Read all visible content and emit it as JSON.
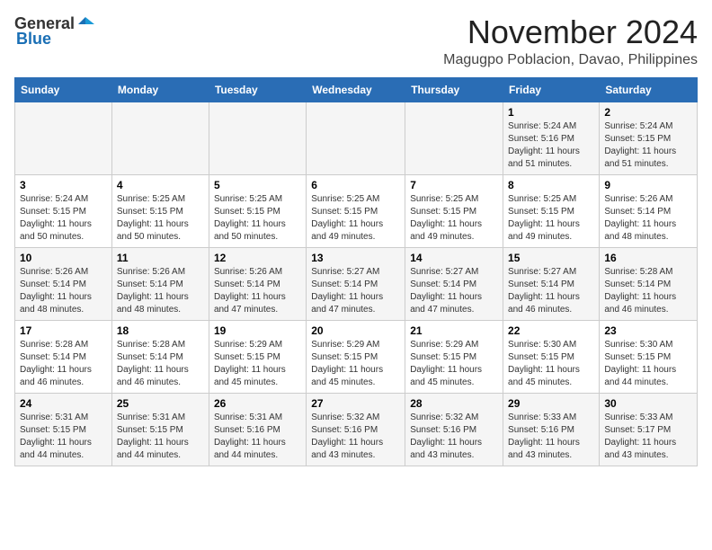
{
  "header": {
    "logo_general": "General",
    "logo_blue": "Blue",
    "month_title": "November 2024",
    "location": "Magugpo Poblacion, Davao, Philippines"
  },
  "weekdays": [
    "Sunday",
    "Monday",
    "Tuesday",
    "Wednesday",
    "Thursday",
    "Friday",
    "Saturday"
  ],
  "weeks": [
    [
      {
        "day": "",
        "sunrise": "",
        "sunset": "",
        "daylight": ""
      },
      {
        "day": "",
        "sunrise": "",
        "sunset": "",
        "daylight": ""
      },
      {
        "day": "",
        "sunrise": "",
        "sunset": "",
        "daylight": ""
      },
      {
        "day": "",
        "sunrise": "",
        "sunset": "",
        "daylight": ""
      },
      {
        "day": "",
        "sunrise": "",
        "sunset": "",
        "daylight": ""
      },
      {
        "day": "1",
        "sunrise": "Sunrise: 5:24 AM",
        "sunset": "Sunset: 5:16 PM",
        "daylight": "Daylight: 11 hours and 51 minutes."
      },
      {
        "day": "2",
        "sunrise": "Sunrise: 5:24 AM",
        "sunset": "Sunset: 5:15 PM",
        "daylight": "Daylight: 11 hours and 51 minutes."
      }
    ],
    [
      {
        "day": "3",
        "sunrise": "Sunrise: 5:24 AM",
        "sunset": "Sunset: 5:15 PM",
        "daylight": "Daylight: 11 hours and 50 minutes."
      },
      {
        "day": "4",
        "sunrise": "Sunrise: 5:25 AM",
        "sunset": "Sunset: 5:15 PM",
        "daylight": "Daylight: 11 hours and 50 minutes."
      },
      {
        "day": "5",
        "sunrise": "Sunrise: 5:25 AM",
        "sunset": "Sunset: 5:15 PM",
        "daylight": "Daylight: 11 hours and 50 minutes."
      },
      {
        "day": "6",
        "sunrise": "Sunrise: 5:25 AM",
        "sunset": "Sunset: 5:15 PM",
        "daylight": "Daylight: 11 hours and 49 minutes."
      },
      {
        "day": "7",
        "sunrise": "Sunrise: 5:25 AM",
        "sunset": "Sunset: 5:15 PM",
        "daylight": "Daylight: 11 hours and 49 minutes."
      },
      {
        "day": "8",
        "sunrise": "Sunrise: 5:25 AM",
        "sunset": "Sunset: 5:15 PM",
        "daylight": "Daylight: 11 hours and 49 minutes."
      },
      {
        "day": "9",
        "sunrise": "Sunrise: 5:26 AM",
        "sunset": "Sunset: 5:14 PM",
        "daylight": "Daylight: 11 hours and 48 minutes."
      }
    ],
    [
      {
        "day": "10",
        "sunrise": "Sunrise: 5:26 AM",
        "sunset": "Sunset: 5:14 PM",
        "daylight": "Daylight: 11 hours and 48 minutes."
      },
      {
        "day": "11",
        "sunrise": "Sunrise: 5:26 AM",
        "sunset": "Sunset: 5:14 PM",
        "daylight": "Daylight: 11 hours and 48 minutes."
      },
      {
        "day": "12",
        "sunrise": "Sunrise: 5:26 AM",
        "sunset": "Sunset: 5:14 PM",
        "daylight": "Daylight: 11 hours and 47 minutes."
      },
      {
        "day": "13",
        "sunrise": "Sunrise: 5:27 AM",
        "sunset": "Sunset: 5:14 PM",
        "daylight": "Daylight: 11 hours and 47 minutes."
      },
      {
        "day": "14",
        "sunrise": "Sunrise: 5:27 AM",
        "sunset": "Sunset: 5:14 PM",
        "daylight": "Daylight: 11 hours and 47 minutes."
      },
      {
        "day": "15",
        "sunrise": "Sunrise: 5:27 AM",
        "sunset": "Sunset: 5:14 PM",
        "daylight": "Daylight: 11 hours and 46 minutes."
      },
      {
        "day": "16",
        "sunrise": "Sunrise: 5:28 AM",
        "sunset": "Sunset: 5:14 PM",
        "daylight": "Daylight: 11 hours and 46 minutes."
      }
    ],
    [
      {
        "day": "17",
        "sunrise": "Sunrise: 5:28 AM",
        "sunset": "Sunset: 5:14 PM",
        "daylight": "Daylight: 11 hours and 46 minutes."
      },
      {
        "day": "18",
        "sunrise": "Sunrise: 5:28 AM",
        "sunset": "Sunset: 5:14 PM",
        "daylight": "Daylight: 11 hours and 46 minutes."
      },
      {
        "day": "19",
        "sunrise": "Sunrise: 5:29 AM",
        "sunset": "Sunset: 5:15 PM",
        "daylight": "Daylight: 11 hours and 45 minutes."
      },
      {
        "day": "20",
        "sunrise": "Sunrise: 5:29 AM",
        "sunset": "Sunset: 5:15 PM",
        "daylight": "Daylight: 11 hours and 45 minutes."
      },
      {
        "day": "21",
        "sunrise": "Sunrise: 5:29 AM",
        "sunset": "Sunset: 5:15 PM",
        "daylight": "Daylight: 11 hours and 45 minutes."
      },
      {
        "day": "22",
        "sunrise": "Sunrise: 5:30 AM",
        "sunset": "Sunset: 5:15 PM",
        "daylight": "Daylight: 11 hours and 45 minutes."
      },
      {
        "day": "23",
        "sunrise": "Sunrise: 5:30 AM",
        "sunset": "Sunset: 5:15 PM",
        "daylight": "Daylight: 11 hours and 44 minutes."
      }
    ],
    [
      {
        "day": "24",
        "sunrise": "Sunrise: 5:31 AM",
        "sunset": "Sunset: 5:15 PM",
        "daylight": "Daylight: 11 hours and 44 minutes."
      },
      {
        "day": "25",
        "sunrise": "Sunrise: 5:31 AM",
        "sunset": "Sunset: 5:15 PM",
        "daylight": "Daylight: 11 hours and 44 minutes."
      },
      {
        "day": "26",
        "sunrise": "Sunrise: 5:31 AM",
        "sunset": "Sunset: 5:16 PM",
        "daylight": "Daylight: 11 hours and 44 minutes."
      },
      {
        "day": "27",
        "sunrise": "Sunrise: 5:32 AM",
        "sunset": "Sunset: 5:16 PM",
        "daylight": "Daylight: 11 hours and 43 minutes."
      },
      {
        "day": "28",
        "sunrise": "Sunrise: 5:32 AM",
        "sunset": "Sunset: 5:16 PM",
        "daylight": "Daylight: 11 hours and 43 minutes."
      },
      {
        "day": "29",
        "sunrise": "Sunrise: 5:33 AM",
        "sunset": "Sunset: 5:16 PM",
        "daylight": "Daylight: 11 hours and 43 minutes."
      },
      {
        "day": "30",
        "sunrise": "Sunrise: 5:33 AM",
        "sunset": "Sunset: 5:17 PM",
        "daylight": "Daylight: 11 hours and 43 minutes."
      }
    ]
  ]
}
